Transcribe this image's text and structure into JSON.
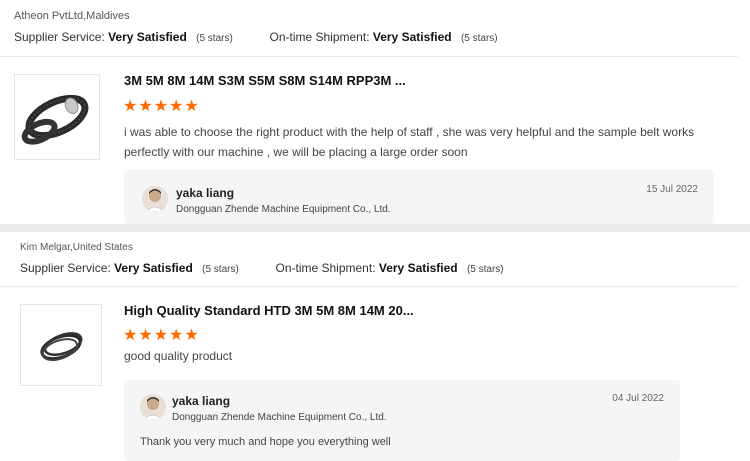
{
  "reviews": [
    {
      "customer": "Atheon PvtLtd,Maldives",
      "supplier_service_label": "Supplier Service:",
      "supplier_service_value": "Very Satisfied",
      "supplier_service_stars": "(5 stars)",
      "shipment_label": "On-time Shipment:",
      "shipment_value": "Very Satisfied",
      "shipment_stars": "(5 stars)",
      "product_title": "3M 5M 8M 14M S3M S5M S8M S14M RPP3M ...",
      "rating": 5,
      "stars": "★★★★★",
      "text": "i was able to choose the right product with the help of staff , she was very helpful and the sample  belt works perfectly with our machine , we will be placing a large order soon",
      "reply": {
        "name": "yaka liang",
        "company": "Dongguan Zhende Machine Equipment Co., Ltd.",
        "date": "15 Jul 2022",
        "message": ""
      }
    },
    {
      "customer": "Kim Melgar,United States",
      "supplier_service_label": "Supplier Service:",
      "supplier_service_value": "Very Satisfied",
      "supplier_service_stars": "(5 stars)",
      "shipment_label": "On-time Shipment:",
      "shipment_value": "Very Satisfied",
      "shipment_stars": "(5 stars)",
      "product_title": "High Quality Standard HTD 3M 5M 8M 14M 20...",
      "rating": 5,
      "stars": "★★★★★",
      "text": "good quality product",
      "reply": {
        "name": "yaka liang",
        "company": "Dongguan Zhende Machine Equipment Co., Ltd.",
        "date": "04 Jul 2022",
        "message": "Thank you very much and hope you everything well"
      }
    }
  ],
  "colors": {
    "star": "#ff6a00",
    "reply_bg": "#f5f5f5"
  },
  "icons": [
    "timing-belt-product-image",
    "belt-product-image",
    "avatar-icon"
  ]
}
